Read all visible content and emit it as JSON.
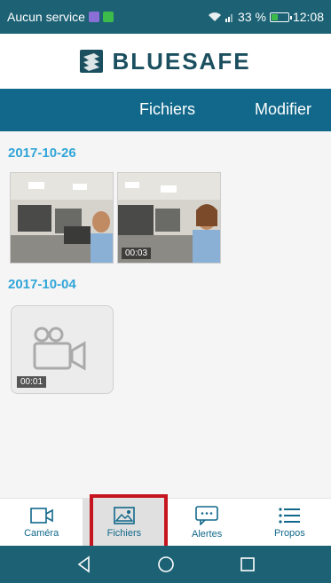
{
  "status_bar": {
    "carrier": "Aucun service",
    "battery": "33 %",
    "time": "12:08",
    "battery_level": 0.33
  },
  "brand": {
    "name": "BLUESAFE"
  },
  "header": {
    "title": "Fichiers",
    "action": "Modifier"
  },
  "groups": [
    {
      "date": "2017-10-26",
      "items": [
        {
          "duration": ""
        },
        {
          "duration": "00:03"
        }
      ]
    },
    {
      "date": "2017-10-04",
      "items": [
        {
          "duration": "00:01",
          "placeholder": true
        }
      ]
    }
  ],
  "tabs": [
    {
      "label": "Caméra",
      "icon": "camera-icon"
    },
    {
      "label": "Fichiers",
      "icon": "image-icon",
      "active": true
    },
    {
      "label": "Alertes",
      "icon": "message-icon"
    },
    {
      "label": "Propos",
      "icon": "menu-icon"
    }
  ],
  "colors": {
    "accent": "#11688a",
    "date_color": "#30a5d8",
    "highlight": "#c6151e"
  }
}
